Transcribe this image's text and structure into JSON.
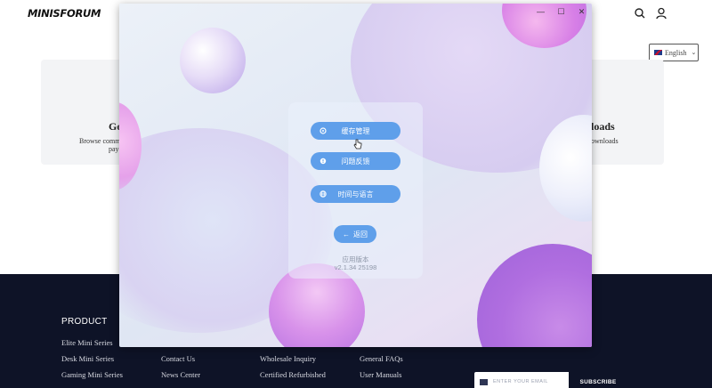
{
  "site": {
    "logo": "MINISFORUM",
    "language": "English",
    "card_left": {
      "title": "Go",
      "line1": "Browse comm",
      "line2": "pay"
    },
    "card_right": {
      "title": "loads",
      "line1": "ownloads"
    },
    "footer": {
      "heading": "PRODUCT",
      "col1": [
        "Elite Mini Series",
        "Desk Mini Series",
        "Gaming Mini Series"
      ],
      "col2": [
        "Contact Us",
        "News Center"
      ],
      "col3": [
        "Wholesale Inquiry",
        "Certified Refurbished"
      ],
      "col4": [
        "General FAQs",
        "User Manuals"
      ],
      "subscribe_placeholder": "ENTER YOUR EMAIL",
      "subscribe_button": "SUBSCRIBE"
    }
  },
  "window": {
    "controls": {
      "minimize": "—",
      "maximize": "☐",
      "close": "✕"
    },
    "menu": {
      "cache": "缓存管理",
      "feedback": "问题反馈",
      "time_language": "时间与语言",
      "back": "返回"
    },
    "version_label": "应用版本",
    "version_value": "v2.1.34 25198"
  },
  "colors": {
    "button": "#5f9fea",
    "footer_bg": "#0e1327"
  }
}
